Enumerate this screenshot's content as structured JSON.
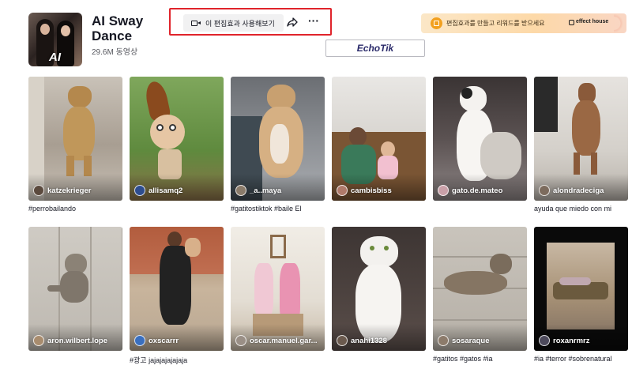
{
  "effect": {
    "title": "AI Sway Dance",
    "thumb_label": "AI",
    "video_count": "29.6M 동영상"
  },
  "actions": {
    "use_effect_label": "이 편집효과 사용해보기",
    "more_label": "···"
  },
  "watermark": "EchoTik",
  "promo": {
    "text": "편집효과를 만들고 리워드를 받으세요",
    "brand": "effect house"
  },
  "videos": [
    {
      "username": "katzekrieger",
      "caption": "#perrobailando",
      "avatar_color": "#5b4a3e"
    },
    {
      "username": "allisamq2",
      "caption": "",
      "avatar_color": "#2e4d8f"
    },
    {
      "username": "_a..maya",
      "caption": "#gatitostiktok #baile El",
      "avatar_color": "#8a7b6a"
    },
    {
      "username": "cambisbiss",
      "caption": "",
      "avatar_color": "#b07a6a"
    },
    {
      "username": "gato.de.mateo",
      "caption": "",
      "avatar_color": "#c9a0a8"
    },
    {
      "username": "alondradeciga",
      "caption": "ayuda que miedo con mi",
      "avatar_color": "#7c6b5d"
    },
    {
      "username": "aron.wilbert.lope",
      "caption": "",
      "avatar_color": "#a88c6e"
    },
    {
      "username": "oxscarrr",
      "caption": "#광고 jajajajajajaja",
      "avatar_color": "#3a6fbf"
    },
    {
      "username": "oscar.manuel.gar...",
      "caption": "",
      "avatar_color": "#9a8f86"
    },
    {
      "username": "anahi1328",
      "caption": "",
      "avatar_color": "#6b5a4e"
    },
    {
      "username": "sosaraque",
      "caption": "#gatitos #gatos #ia",
      "avatar_color": "#8c7b6b"
    },
    {
      "username": "roxanrmrz",
      "caption": "#ia #terror #sobrenatural",
      "avatar_color": "#4d4a5c"
    }
  ]
}
